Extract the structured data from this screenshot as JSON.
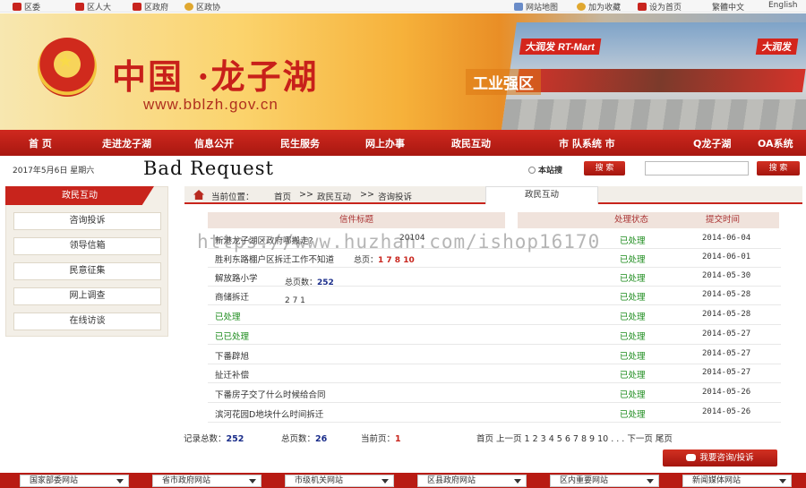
{
  "topbar": {
    "left_links": [
      "区委",
      "区人大",
      "区政府",
      "区政协"
    ],
    "right_links": [
      "网站地图",
      "加为收藏",
      "设为首页",
      "繁體中文",
      "English"
    ]
  },
  "banner": {
    "brand": "中国 ·龙子湖",
    "url": "www.bblzh.gov.cn",
    "tagline": "工业强区",
    "signs": [
      "大润发 RT-Mart",
      "大润发"
    ]
  },
  "nav": {
    "items": [
      "首 页",
      "走进龙子湖",
      "信息公开",
      "民生服务",
      "网上办事",
      "政民互动",
      "市 队系统 市",
      "Q龙子湖",
      "OA系统"
    ]
  },
  "info": {
    "date": "2017年5月6日 星期六",
    "error": "Bad Request",
    "site_search": "本站搜",
    "search_button": "搜 索",
    "search_button2": "搜 索"
  },
  "sidebar": {
    "title": "政民互动",
    "items": [
      "咨询投诉",
      "领导信箱",
      "民意征集",
      "网上调查",
      "在线访谈"
    ]
  },
  "breadcrumb": {
    "label": "当前位置：",
    "path": [
      "首页",
      ">>",
      "政民互动",
      ">>",
      "咨询投诉"
    ],
    "tab": "政民互动"
  },
  "table": {
    "headers": {
      "title": "信件标题",
      "status": "处理状态",
      "time": "提交时间"
    },
    "rows": [
      {
        "title": "新港龙子湖区政府哪搬走?",
        "status": "已处理",
        "time": "2014-06-04",
        "green": false
      },
      {
        "title": "胜利东路棚户区拆迁工作不知道",
        "status": "已处理",
        "time": "2014-06-01",
        "green": false
      },
      {
        "title": "解放路小学",
        "status": "已处理",
        "time": "2014-05-30",
        "green": false
      },
      {
        "title": "商储拆迁",
        "status": "已处理",
        "time": "2014-05-28",
        "green": false
      },
      {
        "title": "已处理",
        "status": "已处理",
        "time": "2014-05-28",
        "green": true
      },
      {
        "title": "已已处理",
        "status": "已处理",
        "time": "2014-05-27",
        "green": true
      },
      {
        "title": "下番辟旭",
        "status": "已处理",
        "time": "2014-05-27",
        "green": false
      },
      {
        "title": "扯迁补偿",
        "status": "已处理",
        "time": "2014-05-27",
        "green": false
      },
      {
        "title": "下番房子交了什么时候给合同",
        "status": "已处理",
        "time": "2014-05-26",
        "green": false
      },
      {
        "title": "滨河花园D地块什么时间拆迁",
        "status": "已处理",
        "time": "2014-05-26",
        "green": false
      }
    ],
    "overlay": {
      "date_frag": "20104",
      "pages_label": "总页：",
      "pages_vals": "1 7 8 10",
      "total_pages_label": "总页数：",
      "total_pages_val": "252",
      "frag": "2 7 1"
    }
  },
  "watermark": "https://www.huzhan.com/ishop16170",
  "pager": {
    "records_label": "记录总数：",
    "records": "252",
    "pages_label": "总页数：",
    "pages": "26",
    "current_label": "当前页：",
    "current": "1",
    "links": "首页 上一页 1 2 3 4 5 6 7 8 9 10 . . .  下一页 尾页",
    "consult_button": "我要咨询/投诉"
  },
  "footer": {
    "selects": [
      "国家部委网站",
      "省市政府网站",
      "市级机关网站",
      "区县政府网站",
      "区内重要网站",
      "新闻媒体网站"
    ]
  }
}
